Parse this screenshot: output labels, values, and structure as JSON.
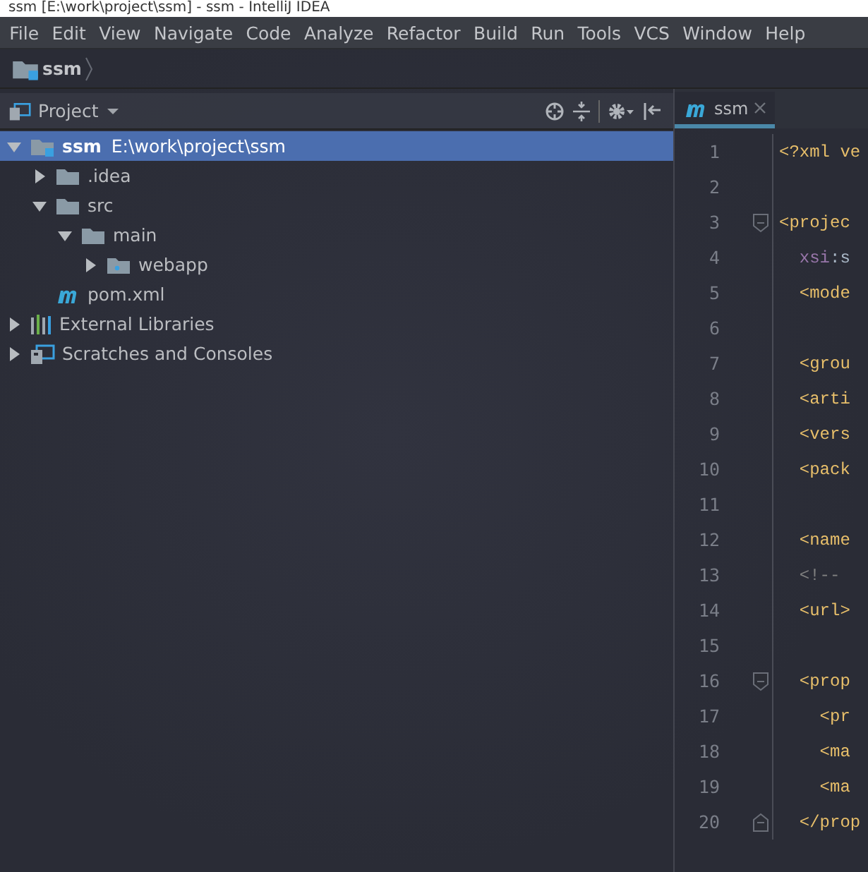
{
  "window": {
    "title": "ssm [E:\\work\\project\\ssm] - ssm - IntelliJ IDEA"
  },
  "menu": [
    "File",
    "Edit",
    "View",
    "Navigate",
    "Code",
    "Analyze",
    "Refactor",
    "Build",
    "Run",
    "Tools",
    "VCS",
    "Window",
    "Help"
  ],
  "breadcrumb": {
    "label": "ssm"
  },
  "project_panel": {
    "title": "Project",
    "tree": [
      {
        "kind": "module",
        "label": "ssm",
        "path": "E:\\work\\project\\ssm",
        "selected": true,
        "expanded": true,
        "children": [
          {
            "kind": "folder",
            "label": ".idea",
            "selected": false,
            "expanded": false
          },
          {
            "kind": "folder",
            "label": "src",
            "selected": false,
            "expanded": true,
            "children": [
              {
                "kind": "folder",
                "label": "main",
                "selected": false,
                "expanded": true,
                "children": [
                  {
                    "kind": "webfolder",
                    "label": "webapp",
                    "selected": false,
                    "expanded": false
                  }
                ]
              }
            ]
          },
          {
            "kind": "maven",
            "label": "pom.xml",
            "selected": false
          }
        ]
      },
      {
        "kind": "libraries",
        "label": "External Libraries",
        "selected": false,
        "expanded": false
      },
      {
        "kind": "scratches",
        "label": "Scratches and Consoles",
        "selected": false,
        "expanded": false
      }
    ]
  },
  "editor": {
    "tabs": [
      {
        "label": "ssm",
        "selected": true
      }
    ],
    "lines": [
      {
        "number": "1",
        "segments": [
          {
            "kind": "tag",
            "text": "<?xml ve"
          }
        ]
      },
      {
        "number": "2"
      },
      {
        "number": "3",
        "fold_start": true,
        "segments": [
          {
            "kind": "tag",
            "text": "<projec"
          }
        ]
      },
      {
        "number": "4",
        "segments": [
          {
            "kind": "attr",
            "text": "  xsi"
          },
          {
            "kind": "plain",
            "text": ":s"
          }
        ]
      },
      {
        "number": "5",
        "segments": [
          {
            "kind": "tag",
            "text": "  <mode"
          }
        ]
      },
      {
        "number": "6"
      },
      {
        "number": "7",
        "segments": [
          {
            "kind": "tag",
            "text": "  <grou"
          }
        ]
      },
      {
        "number": "8",
        "segments": [
          {
            "kind": "tag",
            "text": "  <arti"
          }
        ]
      },
      {
        "number": "9",
        "segments": [
          {
            "kind": "tag",
            "text": "  <vers"
          }
        ]
      },
      {
        "number": "10",
        "segments": [
          {
            "kind": "tag",
            "text": "  <pack"
          }
        ]
      },
      {
        "number": "11"
      },
      {
        "number": "12",
        "segments": [
          {
            "kind": "tag",
            "text": "  <name"
          }
        ]
      },
      {
        "number": "13",
        "segments": [
          {
            "kind": "comment",
            "text": "  <!--"
          }
        ]
      },
      {
        "number": "14",
        "segments": [
          {
            "kind": "tag",
            "text": "  <url>"
          }
        ]
      },
      {
        "number": "15"
      },
      {
        "number": "16",
        "fold_start": true,
        "segments": [
          {
            "kind": "tag",
            "text": "  <prop"
          }
        ]
      },
      {
        "number": "17",
        "segments": [
          {
            "kind": "tag",
            "text": "    <pr"
          }
        ]
      },
      {
        "number": "18",
        "segments": [
          {
            "kind": "tag",
            "text": "    <ma"
          }
        ]
      },
      {
        "number": "19",
        "segments": [
          {
            "kind": "tag",
            "text": "    <ma"
          }
        ]
      },
      {
        "number": "20",
        "fold_end": true,
        "segments": [
          {
            "kind": "tag",
            "text": "  </prop"
          }
        ]
      }
    ]
  }
}
